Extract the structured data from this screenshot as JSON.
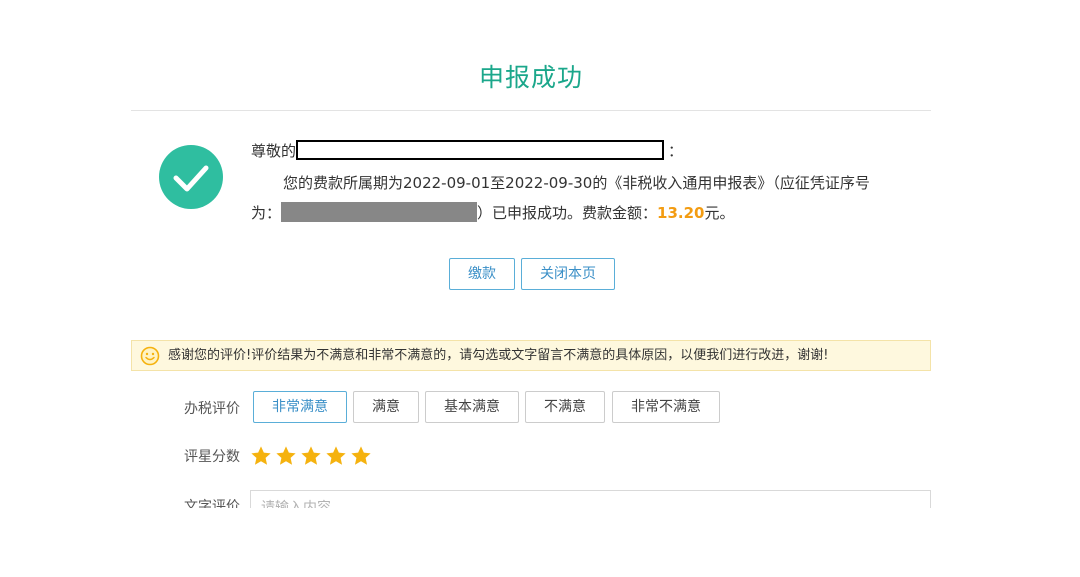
{
  "header": {
    "title": "申报成功"
  },
  "message": {
    "greeting_prefix": "尊敬的",
    "greeting_suffix": "：",
    "line2": "您的费款所属期为2022-09-01至2022-09-30的《非税收入通用申报表》（应征凭证序号",
    "line3_prefix": "为：",
    "line3_middle": "）已申报成功。费款金额：",
    "amount": "13.20",
    "currency": "元。"
  },
  "actions": {
    "pay_label": "缴款",
    "close_label": "关闭本页"
  },
  "feedback": {
    "notice": "感谢您的评价!评价结果为不满意和非常不满意的，请勾选或文字留言不满意的具体原因，以便我们进行改进，谢谢!",
    "rating_label": "办税评价",
    "options": [
      {
        "label": "非常满意",
        "selected": true
      },
      {
        "label": "满意",
        "selected": false
      },
      {
        "label": "基本满意",
        "selected": false
      },
      {
        "label": "不满意",
        "selected": false
      },
      {
        "label": "非常不满意",
        "selected": false
      }
    ],
    "stars_label": "评星分数",
    "stars_value": 5,
    "stars_max": 5,
    "comment_label": "文字评价",
    "comment_placeholder": "请输入内容"
  },
  "colors": {
    "accent_green": "#1ba78b",
    "check_circle": "#2fbea0",
    "amount": "#f39c12",
    "button_border": "#5aaed8",
    "star": "#f5b20f",
    "notice_bg": "#fef8de"
  },
  "icons": {
    "success": "check-circle-icon",
    "notice": "smile-icon",
    "star": "star-icon"
  }
}
